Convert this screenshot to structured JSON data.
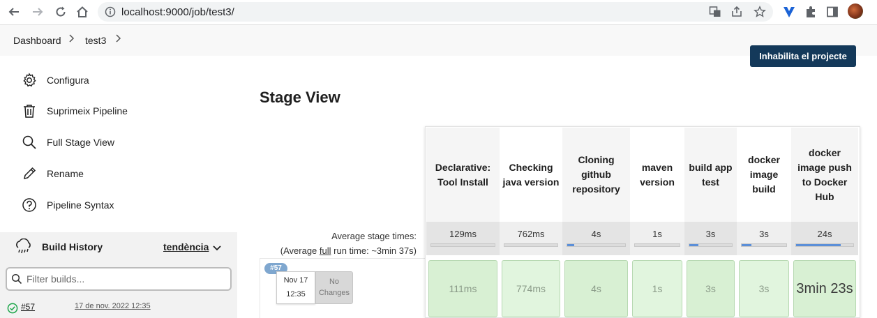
{
  "browser": {
    "url": "localhost:9000/job/test3/"
  },
  "breadcrumb": {
    "items": [
      "Dashboard",
      "test3"
    ],
    "separator": ">"
  },
  "sidebar": {
    "items": [
      {
        "label": "Configura",
        "icon": "gear-icon"
      },
      {
        "label": "Suprimeix Pipeline",
        "icon": "trash-icon"
      },
      {
        "label": "Full Stage View",
        "icon": "search-icon"
      },
      {
        "label": "Rename",
        "icon": "pencil-icon"
      },
      {
        "label": "Pipeline Syntax",
        "icon": "help-icon"
      }
    ]
  },
  "build_history": {
    "title": "Build History",
    "trend_label": "tendència",
    "filter_placeholder": "Filter builds...",
    "builds": [
      {
        "number": "#57",
        "date": "17 de nov. 2022 12:35",
        "status": "success"
      }
    ]
  },
  "main": {
    "disable_button": "Inhabilita el projecte",
    "stage_view_title": "Stage View",
    "average_label": "Average stage times:",
    "average_full_prefix": "(Average ",
    "average_full_link": "full",
    "average_full_suffix": " run time: ~3min 37s)"
  },
  "stages": [
    {
      "name": "Declarative: Tool Install",
      "avg": "129ms",
      "avg_fill": 0.0,
      "run_time": "111ms"
    },
    {
      "name": "Checking java version",
      "avg": "762ms",
      "avg_fill": 0.0,
      "run_time": "774ms"
    },
    {
      "name": "Cloning github repository",
      "avg": "4s",
      "avg_fill": 0.12,
      "run_time": "4s"
    },
    {
      "name": "maven version",
      "avg": "1s",
      "avg_fill": 0.0,
      "run_time": "1s"
    },
    {
      "name": "build app test",
      "avg": "3s",
      "avg_fill": 0.22,
      "run_time": "3s"
    },
    {
      "name": "docker image build",
      "avg": "3s",
      "avg_fill": 0.22,
      "run_time": "3s"
    },
    {
      "name": "docker image push to Docker Hub",
      "avg": "24s",
      "avg_fill": 0.78,
      "run_time": "3min 23s"
    }
  ],
  "run": {
    "badge": "#57",
    "date_line1": "Nov 17",
    "date_line2": "12:35",
    "changes_line1": "No",
    "changes_line2": "Changes"
  },
  "colors": {
    "accent": "#14395a",
    "success_cell": "#e1f5de",
    "badge": "#7fa7cf"
  }
}
